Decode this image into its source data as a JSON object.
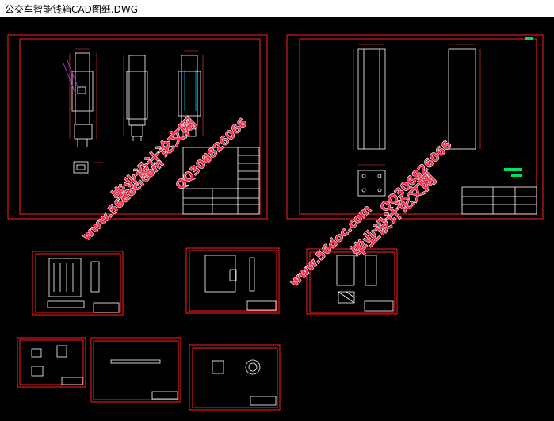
{
  "window": {
    "title": "公交车智能钱箱CAD图纸.DWG"
  },
  "colors": {
    "background": "#000000",
    "frame": "#ff2020",
    "drawing": "#ffffff",
    "watermark": "#ff2a4a",
    "accent": "#00e060",
    "dimension": "#ff4040"
  },
  "watermarks": {
    "brand": "毕业设计论文网",
    "site": "www.56doc.com",
    "qq": "QQ306826066"
  }
}
